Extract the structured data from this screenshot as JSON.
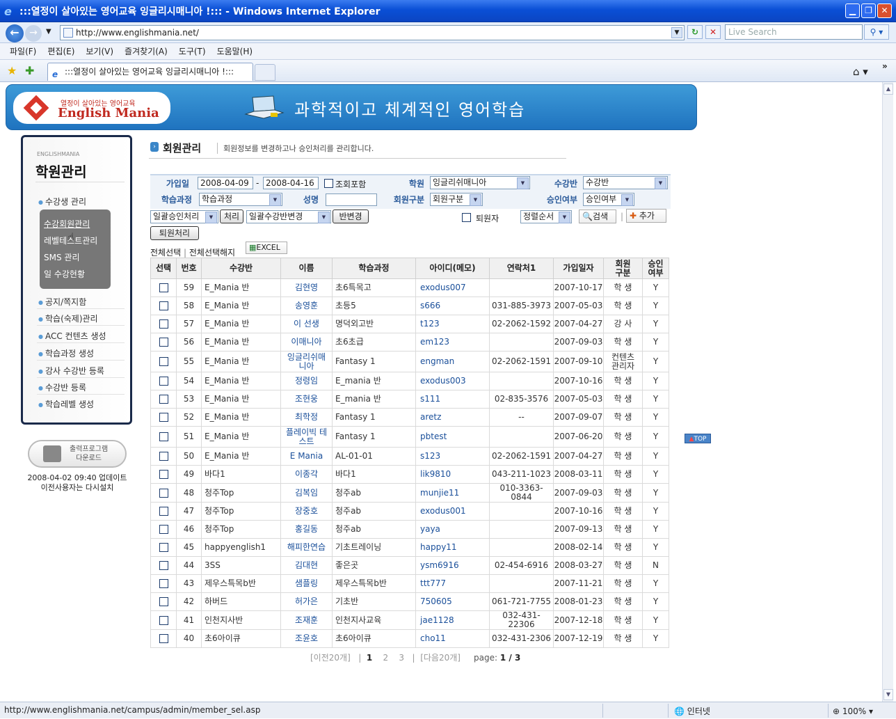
{
  "window": {
    "title": ":::열정이 살아있는 영어교육 잉글리시매니아 !::: - Windows Internet Explorer",
    "url": "http://www.englishmania.net/",
    "live_search_placeholder": "Live Search",
    "tab_title": ":::열정이 살아있는 영어교육 잉글리시매니아 !:::",
    "menu": [
      "파일(F)",
      "편집(E)",
      "보기(V)",
      "즐겨찾기(A)",
      "도구(T)",
      "도움말(H)"
    ],
    "status_url": "http://www.englishmania.net/campus/admin/member_sel.asp",
    "zone": "인터넷",
    "zoom": "100%"
  },
  "banner": {
    "logo_top": "열정이 살아있는 영어교육",
    "logo_main": "English Mania",
    "slogan": "과학적이고  체계적인  영어학습"
  },
  "sidebar": {
    "eng_label": "ENGLISHMANIA",
    "title": "학원관리",
    "item_students": "수강생 관리",
    "sub_items": [
      "수강회원관리",
      "레벨테스트관리",
      "SMS 관리",
      "일 수강현황"
    ],
    "items": [
      "공지/쪽지함",
      "학습(숙제)관리",
      "ACC 컨텐츠 생성",
      "학습과정 생성",
      "강사 수강반 등록",
      "수강반 등록",
      "학습레벨 생성"
    ],
    "print_button": "출력프로그램\n다운로드",
    "update_line1": "2008-04-02 09:40 업데이트",
    "update_line2": "이전사용자는 다시설치"
  },
  "section": {
    "title": "회원관리",
    "desc": "회원정보를 변경하고나 승인처리를 관리합니다."
  },
  "filters": {
    "join_date_label": "가입일",
    "date_from": "2008-04-09",
    "date_sep": "-",
    "date_to": "2008-04-16",
    "include_query": "조회포함",
    "academy_label": "학원",
    "academy_value": "잉글리쉬매니아",
    "class_label": "수강반",
    "class_value": "수강반",
    "course_label": "학습과정",
    "course_value": "학습과정",
    "name_label": "성명",
    "member_type_label": "회원구분",
    "member_type_value": "회원구분",
    "approval_label": "승인여부",
    "approval_value": "승인여부"
  },
  "actions": {
    "bulk_approve": "일괄승인처리",
    "process_button": "처리",
    "bulk_class_change": "일괄수강반변경",
    "class_change_button": "반변경",
    "withdrawn_label": "퇴원자",
    "sort_value": "정렬순서",
    "search_button": "검색",
    "add_button": "추가",
    "withdraw_button": "퇴원처리",
    "select_all": "전체선택",
    "deselect_all": "전체선택해지",
    "excel": "EXCEL"
  },
  "table": {
    "headers": [
      "선택",
      "번호",
      "수강반",
      "이름",
      "학습과정",
      "아이디(메모)",
      "연락처1",
      "가입일자",
      "회원\n구분",
      "승인\n여부"
    ],
    "rows": [
      [
        "59",
        "E_Mania 반",
        "김현영",
        "초6특목고",
        "exodus007",
        "",
        "2007-10-17",
        "학 생",
        "Y"
      ],
      [
        "58",
        "E_Mania 반",
        "송영훈",
        "초등5",
        "s666",
        "031-885-3973",
        "2007-05-03",
        "학 생",
        "Y"
      ],
      [
        "57",
        "E_Mania 반",
        "이 선생",
        "명덕외고반",
        "t123",
        "02-2062-1592",
        "2007-04-27",
        "강 사",
        "Y"
      ],
      [
        "56",
        "E_Mania 반",
        "이매니아",
        "초6초급",
        "em123",
        "",
        "2007-09-03",
        "학 생",
        "Y"
      ],
      [
        "55",
        "E_Mania 반",
        "잉글리쉬매\n니아",
        "Fantasy 1",
        "engman",
        "02-2062-1591",
        "2007-09-10",
        "컨텐츠\n관리자",
        "Y"
      ],
      [
        "54",
        "E_Mania 반",
        "정령임",
        "E_mania 반",
        "exodus003",
        "",
        "2007-10-16",
        "학 생",
        "Y"
      ],
      [
        "53",
        "E_Mania 반",
        "조현웅",
        "E_mania 반",
        "s111",
        "02-835-3576",
        "2007-05-03",
        "학 생",
        "Y"
      ],
      [
        "52",
        "E_Mania 반",
        "최학정",
        "Fantasy 1",
        "aretz",
        "--",
        "2007-09-07",
        "학 생",
        "Y"
      ],
      [
        "51",
        "E_Mania 반",
        "플레이빅 테\n스트",
        "Fantasy 1",
        "pbtest",
        "",
        "2007-06-20",
        "학 생",
        "Y"
      ],
      [
        "50",
        "E_Mania 반",
        "E Mania",
        "AL-01-01",
        "s123",
        "02-2062-1591",
        "2007-04-27",
        "학 생",
        "Y"
      ],
      [
        "49",
        "바다1",
        "이종각",
        "바다1",
        "lik9810",
        "043-211-1023",
        "2008-03-11",
        "학 생",
        "Y"
      ],
      [
        "48",
        "청주Top",
        "김복임",
        "청주ab",
        "munjie11",
        "010-3363-0844",
        "2007-09-03",
        "학 생",
        "Y"
      ],
      [
        "47",
        "청주Top",
        "장중호",
        "청주ab",
        "exodus001",
        "",
        "2007-10-16",
        "학 생",
        "Y"
      ],
      [
        "46",
        "청주Top",
        "홍길동",
        "청주ab",
        "yaya",
        "",
        "2007-09-13",
        "학 생",
        "Y"
      ],
      [
        "45",
        "happyenglish1",
        "해피한연습",
        "기초트레이닝",
        "happy11",
        "",
        "2008-02-14",
        "학 생",
        "Y"
      ],
      [
        "44",
        "3SS",
        "김대현",
        "좋은곳",
        "ysm6916",
        "02-454-6916",
        "2008-03-27",
        "학 생",
        "N"
      ],
      [
        "43",
        "제우스특목b반",
        "샘플링",
        "제우스특목b반",
        "ttt777",
        "",
        "2007-11-21",
        "학 생",
        "Y"
      ],
      [
        "42",
        "하버드",
        "허가은",
        "기초반",
        "750605",
        "061-721-7755",
        "2008-01-23",
        "학 생",
        "Y"
      ],
      [
        "41",
        "인천지사반",
        "조재훈",
        "인천지사교육",
        "jae1128",
        "032-431-22306",
        "2007-12-18",
        "학 생",
        "Y"
      ],
      [
        "40",
        "초6아이큐",
        "조윤호",
        "초6아이큐",
        "cho11",
        "032-431-2306",
        "2007-12-19",
        "학 생",
        "Y"
      ]
    ]
  },
  "pager": {
    "prev": "[이전20개]",
    "pages": [
      "1",
      "2",
      "3"
    ],
    "next": "[다음20개]",
    "page_label": "page:",
    "page_info": "1 / 3"
  },
  "top_link": "TOP"
}
